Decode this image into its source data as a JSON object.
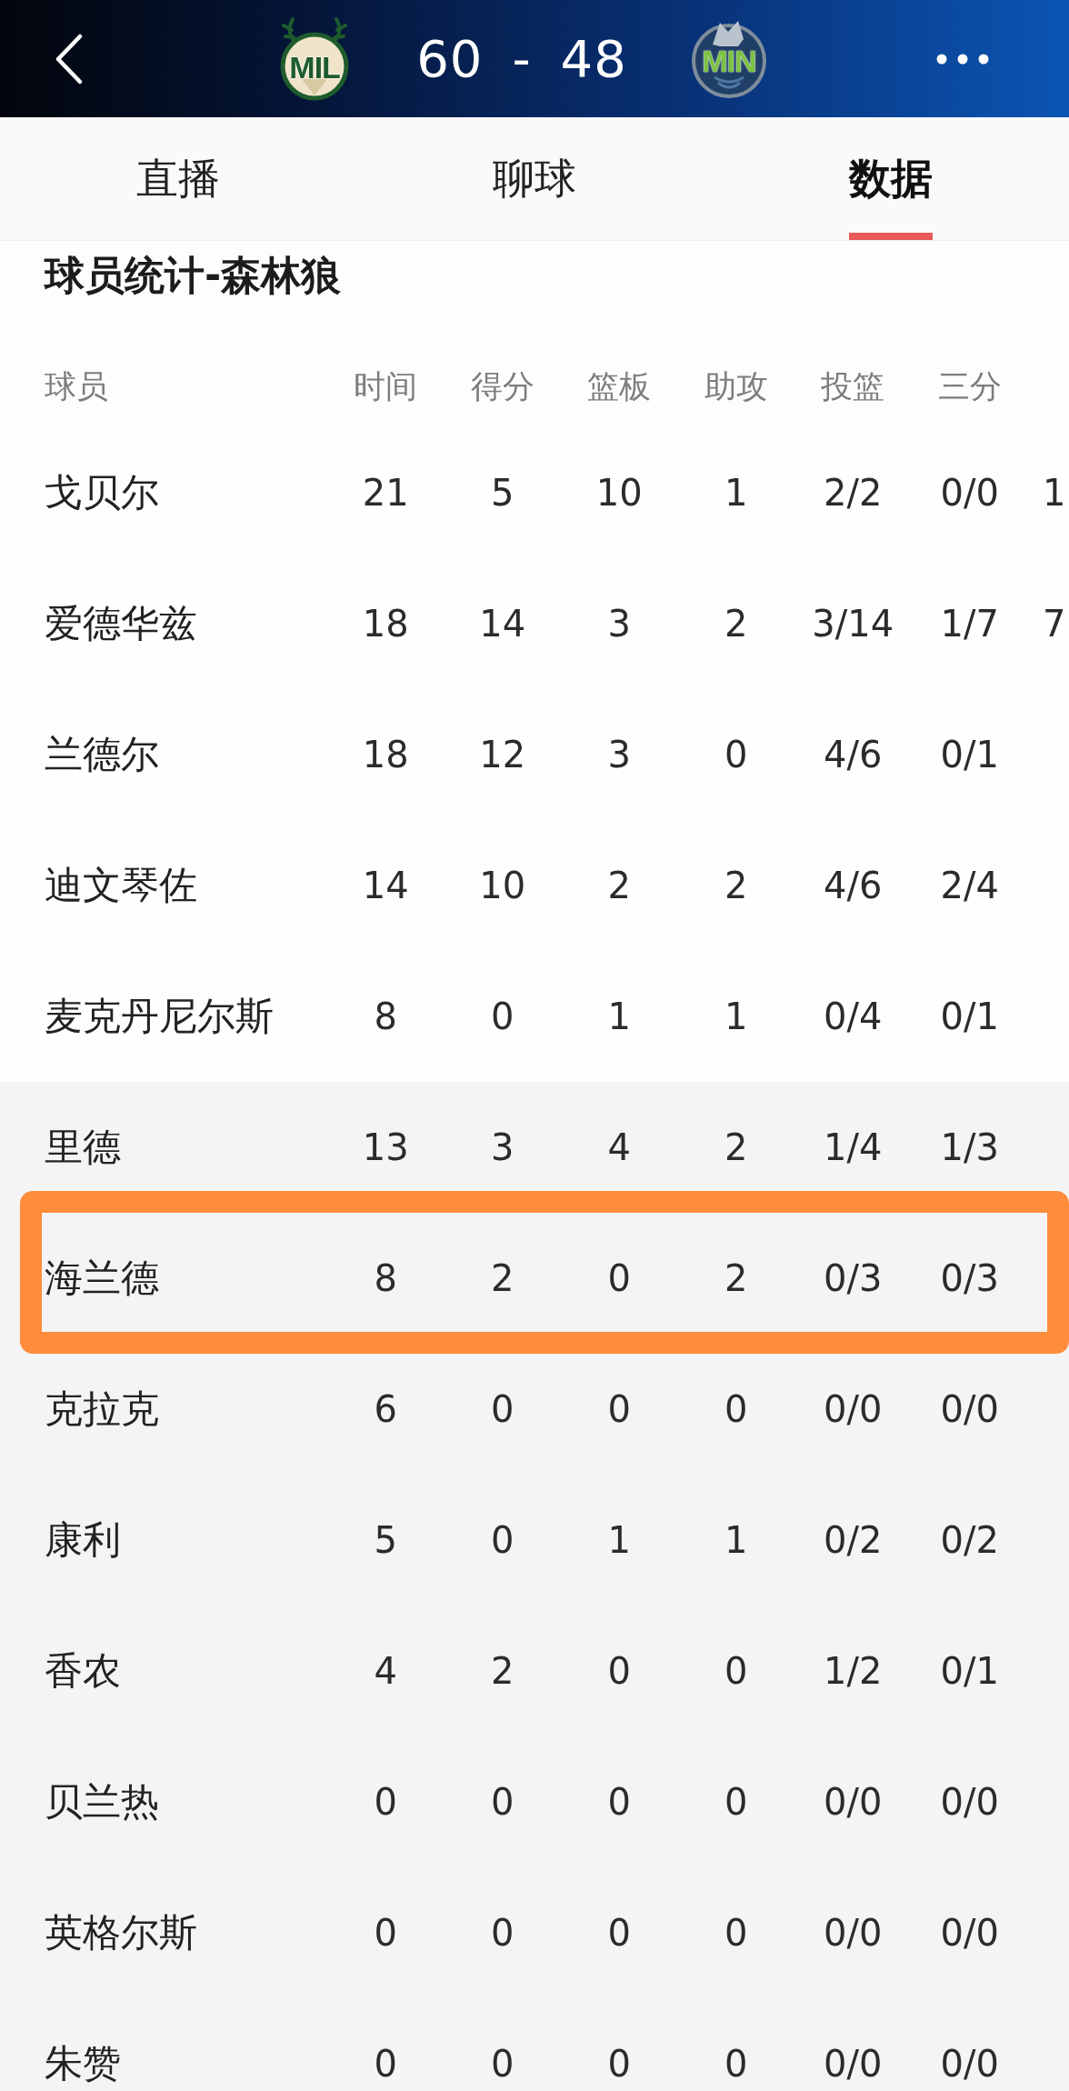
{
  "header": {
    "home_team": {
      "abbreviation": "MIL"
    },
    "home_score": "60",
    "separator": "-",
    "away_score": "48",
    "away_team": {
      "abbreviation": "MIN"
    }
  },
  "tabs": [
    {
      "label": "直播",
      "selected": false
    },
    {
      "label": "聊球",
      "selected": false
    },
    {
      "label": "数据",
      "selected": true
    }
  ],
  "section_title": "球员统计-森林狼",
  "table": {
    "columns": [
      "球员",
      "时间",
      "得分",
      "篮板",
      "助攻",
      "投篮",
      "三分"
    ],
    "starters": [
      {
        "player": "戈贝尔",
        "stats": [
          "21",
          "5",
          "10",
          "1",
          "2/2",
          "0/0"
        ],
        "column_8": "1",
        "highlighted": false
      },
      {
        "player": "爱德华兹",
        "stats": [
          "18",
          "14",
          "3",
          "2",
          "3/14",
          "1/7"
        ],
        "column_8": "7",
        "highlighted": false
      },
      {
        "player": "兰德尔",
        "stats": [
          "18",
          "12",
          "3",
          "0",
          "4/6",
          "0/1"
        ],
        "highlighted": false
      },
      {
        "player": "迪文琴佐",
        "stats": [
          "14",
          "10",
          "2",
          "2",
          "4/6",
          "2/4"
        ],
        "highlighted": false
      },
      {
        "player": "麦克丹尼尔斯",
        "stats": [
          "8",
          "0",
          "1",
          "1",
          "0/4",
          "0/1"
        ],
        "highlighted": false
      }
    ],
    "bench": [
      {
        "player": "里德",
        "stats": [
          "13",
          "3",
          "4",
          "2",
          "1/4",
          "1/3"
        ],
        "highlighted": false
      },
      {
        "player": "海兰德",
        "stats": [
          "8",
          "2",
          "0",
          "2",
          "0/3",
          "0/3"
        ],
        "highlighted": true
      },
      {
        "player": "克拉克",
        "stats": [
          "6",
          "0",
          "0",
          "0",
          "0/0",
          "0/0"
        ],
        "highlighted": false
      },
      {
        "player": "康利",
        "stats": [
          "5",
          "0",
          "1",
          "1",
          "0/2",
          "0/2"
        ],
        "highlighted": false
      },
      {
        "player": "香农",
        "stats": [
          "4",
          "2",
          "0",
          "0",
          "1/2",
          "0/1"
        ],
        "highlighted": false
      },
      {
        "player": "贝兰热",
        "stats": [
          "0",
          "0",
          "0",
          "0",
          "0/0",
          "0/0"
        ],
        "highlighted": false
      },
      {
        "player": "英格尔斯",
        "stats": [
          "0",
          "0",
          "0",
          "0",
          "0/0",
          "0/0"
        ],
        "highlighted": false
      },
      {
        "player": "朱赞",
        "stats": [
          "0",
          "0",
          "0",
          "0",
          "0/0",
          "0/0"
        ],
        "highlighted": false
      }
    ]
  }
}
